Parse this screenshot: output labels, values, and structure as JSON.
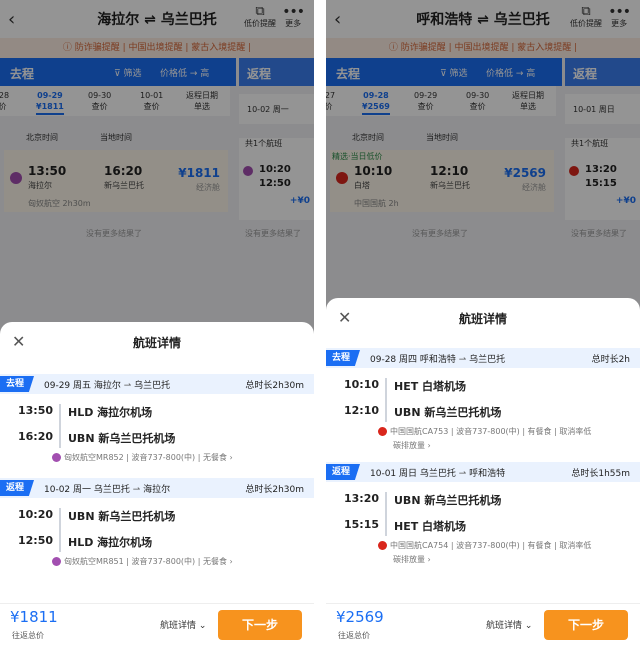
{
  "colors": {
    "accent": "#1b6ef3",
    "orange": "#f7931e",
    "notice": "#d6683a"
  },
  "panels": [
    {
      "route_title": "海拉尔 ⇌ 乌兰巴托",
      "price_alert_label": "低价提醒",
      "more_label": "更多",
      "notice": "ⓘ 防诈骗提醒 | 中国出境提醒 | 蒙古入境提醒 |",
      "outbound_tab": "去程",
      "filter_label": "筛选",
      "sort_label": "价格低 → 高",
      "return_tab": "返程",
      "dates": [
        {
          "d": "-28",
          "p": "价"
        },
        {
          "d": "09-29",
          "p": "¥1811",
          "sel": true
        },
        {
          "d": "09-30",
          "p": "查价"
        },
        {
          "d": "10-01",
          "p": "查价"
        },
        {
          "d": "返程日期",
          "p": "单选"
        }
      ],
      "return_date": "10-02 周一",
      "col_dep": "北京时间",
      "col_arr": "当地时间",
      "flight": {
        "tag": "",
        "dep": "13:50",
        "dep_apt": "海拉尔",
        "arr": "16:20",
        "arr_apt": "新乌兰巴托",
        "price": "¥1811",
        "cls": "经济舱",
        "dur": "匈奴航空 2h30m"
      },
      "ret_card": {
        "count": "共1个航班",
        "t1": "10:20",
        "t2": "12:50",
        "plus": "+¥0"
      },
      "no_more": "没有更多结果了",
      "no_more_r": "没有更多结果了",
      "sheet_title": "航班详情",
      "legs": [
        {
          "badge": "去程",
          "date": "09-29 周五",
          "from": "海拉尔",
          "to": "乌兰巴托",
          "dur": "总时长2h30m",
          "t1": "13:50",
          "a1": "HLD 海拉尔机场",
          "t2": "16:20",
          "a2": "UBN 新乌兰巴托机场",
          "meta": "匈奴航空MR852 | 波音737-800(中) | 无餐食 ›",
          "meta2": ""
        },
        {
          "badge": "返程",
          "date": "10-02 周一",
          "from": "乌兰巴托",
          "to": "海拉尔",
          "dur": "总时长2h30m",
          "t1": "10:20",
          "a1": "UBN 新乌兰巴托机场",
          "t2": "12:50",
          "a2": "HLD 海拉尔机场",
          "meta": "匈奴航空MR851 | 波音737-800(中) | 无餐食 ›",
          "meta2": ""
        }
      ],
      "footer": {
        "price": "¥1811",
        "label": "往返总价",
        "detail": "航班详情 ⌄",
        "next": "下一步"
      }
    },
    {
      "route_title": "呼和浩特 ⇌ 乌兰巴托",
      "price_alert_label": "低价提醒",
      "more_label": "更多",
      "notice": "ⓘ 防诈骗提醒 | 中国出境提醒 | 蒙古入境提醒 |",
      "outbound_tab": "去程",
      "filter_label": "筛选",
      "sort_label": "价格低 → 高",
      "return_tab": "返程",
      "dates": [
        {
          "d": "-27",
          "p": "价"
        },
        {
          "d": "09-28",
          "p": "¥2569",
          "sel": true
        },
        {
          "d": "09-29",
          "p": "查价"
        },
        {
          "d": "09-30",
          "p": "查价"
        },
        {
          "d": "返程日期",
          "p": "单选"
        }
      ],
      "return_date": "10-01 周日",
      "col_dep": "北京时间",
      "col_arr": "当地时间",
      "flight": {
        "tag": "精选·当日低价",
        "dep": "10:10",
        "dep_apt": "白塔",
        "arr": "12:10",
        "arr_apt": "新乌兰巴托",
        "price": "¥2569",
        "cls": "经济舱",
        "dur": "中国国航 2h"
      },
      "ret_card": {
        "count": "共1个航班",
        "t1": "13:20",
        "t2": "15:15",
        "plus": "+¥0"
      },
      "no_more": "没有更多结果了",
      "no_more_r": "没有更多结果了",
      "sheet_title": "航班详情",
      "legs": [
        {
          "badge": "去程",
          "date": "09-28 周四",
          "from": "呼和浩特",
          "to": "乌兰巴托",
          "dur": "总时长2h",
          "t1": "10:10",
          "a1": "HET 白塔机场",
          "t2": "12:10",
          "a2": "UBN 新乌兰巴托机场",
          "meta": "中国国航CA753 | 波音737-800(中) | 有餐食 | 取消率低",
          "meta2": "碳排放量 ›"
        },
        {
          "badge": "返程",
          "date": "10-01 周日",
          "from": "乌兰巴托",
          "to": "呼和浩特",
          "dur": "总时长1h55m",
          "t1": "13:20",
          "a1": "UBN 新乌兰巴托机场",
          "t2": "15:15",
          "a2": "HET 白塔机场",
          "meta": "中国国航CA754 | 波音737-800(中) | 有餐食 | 取消率低",
          "meta2": "碳排放量 ›"
        }
      ],
      "footer": {
        "price": "¥2569",
        "label": "往返总价",
        "detail": "航班详情 ⌄",
        "next": "下一步"
      }
    }
  ]
}
